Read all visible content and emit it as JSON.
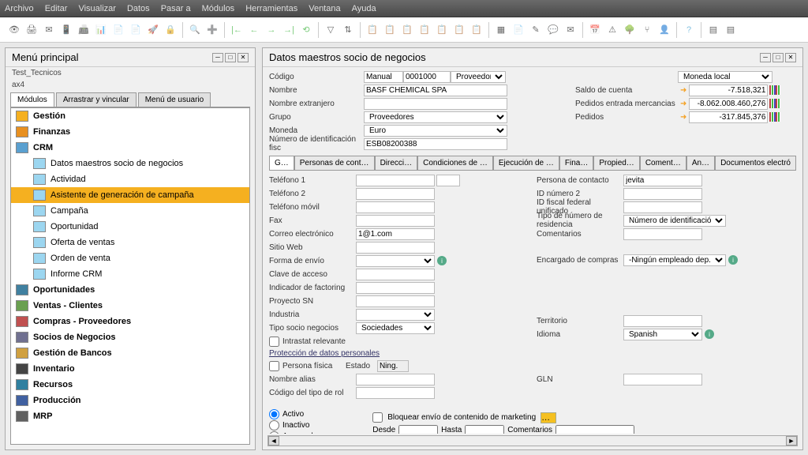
{
  "menubar": [
    "Archivo",
    "Editar",
    "Visualizar",
    "Datos",
    "Pasar a",
    "Módulos",
    "Herramientas",
    "Ventana",
    "Ayuda"
  ],
  "left_panel": {
    "title": "Menú principal",
    "sub1": "Test_Tecnicos",
    "sub2": "ax4",
    "tabs": [
      "Módulos",
      "Arrastrar y vincular",
      "Menú de usuario"
    ],
    "tree": [
      {
        "label": "Gestión",
        "bold": true,
        "icon": "#f5b020"
      },
      {
        "label": "Finanzas",
        "bold": true,
        "icon": "#e89020"
      },
      {
        "label": "CRM",
        "bold": true,
        "icon": "#5aa0d0"
      },
      {
        "label": "Datos maestros socio de negocios",
        "sub": true
      },
      {
        "label": "Actividad",
        "sub": true
      },
      {
        "label": "Asistente de generación de campaña",
        "sub": true,
        "selected": true
      },
      {
        "label": "Campaña",
        "sub": true
      },
      {
        "label": "Oportunidad",
        "sub": true
      },
      {
        "label": "Oferta de ventas",
        "sub": true
      },
      {
        "label": "Orden de venta",
        "sub": true
      },
      {
        "label": "Informe CRM",
        "sub": true
      },
      {
        "label": "Oportunidades",
        "bold": true,
        "icon": "#4080a0"
      },
      {
        "label": "Ventas - Clientes",
        "bold": true,
        "icon": "#6aa050"
      },
      {
        "label": "Compras - Proveedores",
        "bold": true,
        "icon": "#c05050"
      },
      {
        "label": "Socios de Negocios",
        "bold": true,
        "icon": "#707090"
      },
      {
        "label": "Gestión de Bancos",
        "bold": true,
        "icon": "#d0a040"
      },
      {
        "label": "Inventario",
        "bold": true,
        "icon": "#444"
      },
      {
        "label": "Recursos",
        "bold": true,
        "icon": "#3080a0"
      },
      {
        "label": "Producción",
        "bold": true,
        "icon": "#4060a0"
      },
      {
        "label": "MRP",
        "bold": true,
        "icon": "#606060"
      }
    ]
  },
  "right_panel": {
    "title": "Datos maestros socio de negocios",
    "header": {
      "codigo": "0001000",
      "codigo_tipo": "Manual",
      "tipo_sn": "Proveedor",
      "nombre": "BASF CHEMICAL SPA",
      "nombre_extranjero": "",
      "grupo": "Proveedores",
      "moneda": "Euro",
      "nif": "ESB08200388",
      "moneda_display": "Moneda local",
      "labels": {
        "codigo": "Código",
        "nombre": "Nombre",
        "nombre_extranjero": "Nombre extranjero",
        "grupo": "Grupo",
        "moneda": "Moneda",
        "nif": "Número de identificación fisc"
      }
    },
    "balances": {
      "saldo_cuenta": {
        "label": "Saldo de cuenta",
        "value": "-7.518,321"
      },
      "pedidos_entrada": {
        "label": "Pedidos entrada mercancias",
        "value": "-8.062.008.460,276"
      },
      "pedidos": {
        "label": "Pedidos",
        "value": "-317.845,376"
      }
    },
    "tabs": [
      "G…",
      "Personas de cont…",
      "Direcci…",
      "Condiciones de …",
      "Ejecución de …",
      "Fina…",
      "Propied…",
      "Coment…",
      "An…",
      "Documentos electró"
    ],
    "general": {
      "left": {
        "telefono1": {
          "label": "Teléfono 1",
          "value": ""
        },
        "telefono2": {
          "label": "Teléfono 2",
          "value": ""
        },
        "movil": {
          "label": "Teléfono móvil",
          "value": ""
        },
        "fax": {
          "label": "Fax",
          "value": ""
        },
        "email": {
          "label": "Correo electrónico",
          "value": "1@1.com"
        },
        "web": {
          "label": "Sitio Web",
          "value": ""
        },
        "envio": {
          "label": "Forma de envío",
          "value": ""
        },
        "claveacceso": {
          "label": "Clave de acceso",
          "value": ""
        },
        "factoring": {
          "label": "Indicador de factoring",
          "value": ""
        },
        "proyecto": {
          "label": "Proyecto SN",
          "value": ""
        },
        "industria": {
          "label": "Industria",
          "value": ""
        },
        "tiposocio": {
          "label": "Tipo socio negocios",
          "value": "Sociedades"
        },
        "intrastat": {
          "label": "Intrastat relevante",
          "value": false
        },
        "pdp_header": "Protección de datos personales",
        "persona_fisica": {
          "label": "Persona física",
          "value": false
        },
        "estado": {
          "label": "Estado",
          "value": "Ning."
        },
        "alias": {
          "label": "Nombre alias",
          "value": ""
        },
        "tiporol": {
          "label": "Código del tipo de rol",
          "value": ""
        }
      },
      "right": {
        "contacto": {
          "label": "Persona de contacto",
          "value": "jevita"
        },
        "id2": {
          "label": "ID número 2",
          "value": ""
        },
        "idfiscal": {
          "label": "ID fiscal federal unificado",
          "value": ""
        },
        "tiponumres": {
          "label": "Tipo de número de residencia",
          "value": "Número de identificación fis"
        },
        "comentarios": {
          "label": "Comentarios",
          "value": ""
        },
        "encargado": {
          "label": "Encargado de compras",
          "value": "-Ningún empleado dep.ven"
        },
        "territorio": {
          "label": "Territorio",
          "value": ""
        },
        "idioma": {
          "label": "Idioma",
          "value": "Spanish"
        },
        "gln": {
          "label": "GLN",
          "value": ""
        }
      }
    },
    "footer": {
      "activo": "Activo",
      "inactivo": "Inactivo",
      "avanzado": "Avanzado",
      "desde": "Desde",
      "hasta": "Hasta",
      "comentarios": "Comentarios",
      "bloquear": "Bloquear envío de contenido de marketing"
    }
  }
}
